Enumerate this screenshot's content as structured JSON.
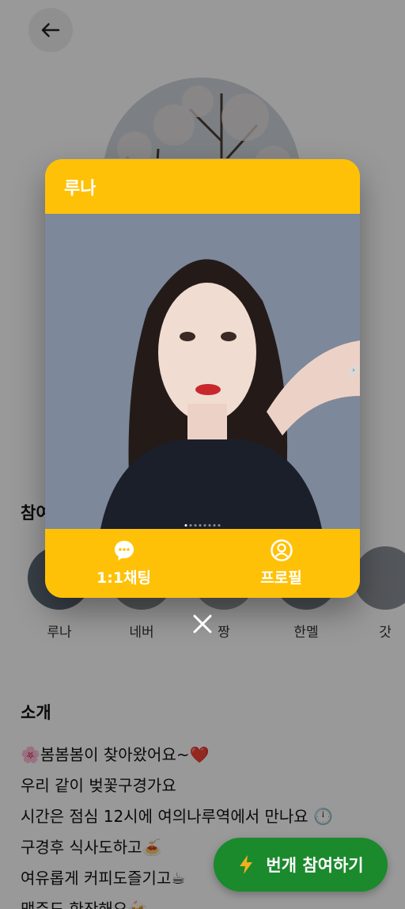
{
  "modal": {
    "title": "루나",
    "chat_label": "1:1채팅",
    "profile_label": "프로필"
  },
  "sections": {
    "participants_title": "참여",
    "intro_title": "소개"
  },
  "participants": [
    "루나",
    "네버",
    "짱",
    "한멜",
    "갓"
  ],
  "intro_lines": [
    "🌸봄봄봄이 찾아왔어요~❤️",
    "우리 같이 벚꽃구경가요",
    "시간은 점심 12시에 여의나루역에서 만나요 🕛",
    "구경후 식사도하고🍝",
    "여유롭게 커피도즐기고☕",
    "맥주도 한잔해요🍻"
  ],
  "join_button": "번개 참여하기",
  "colors": {
    "accent": "#ffc107",
    "join": "#1a8a2c"
  },
  "icons": [
    "back-arrow-icon",
    "chat-bubble-icon",
    "person-icon",
    "close-icon",
    "lightning-icon",
    "crown-icon"
  ]
}
